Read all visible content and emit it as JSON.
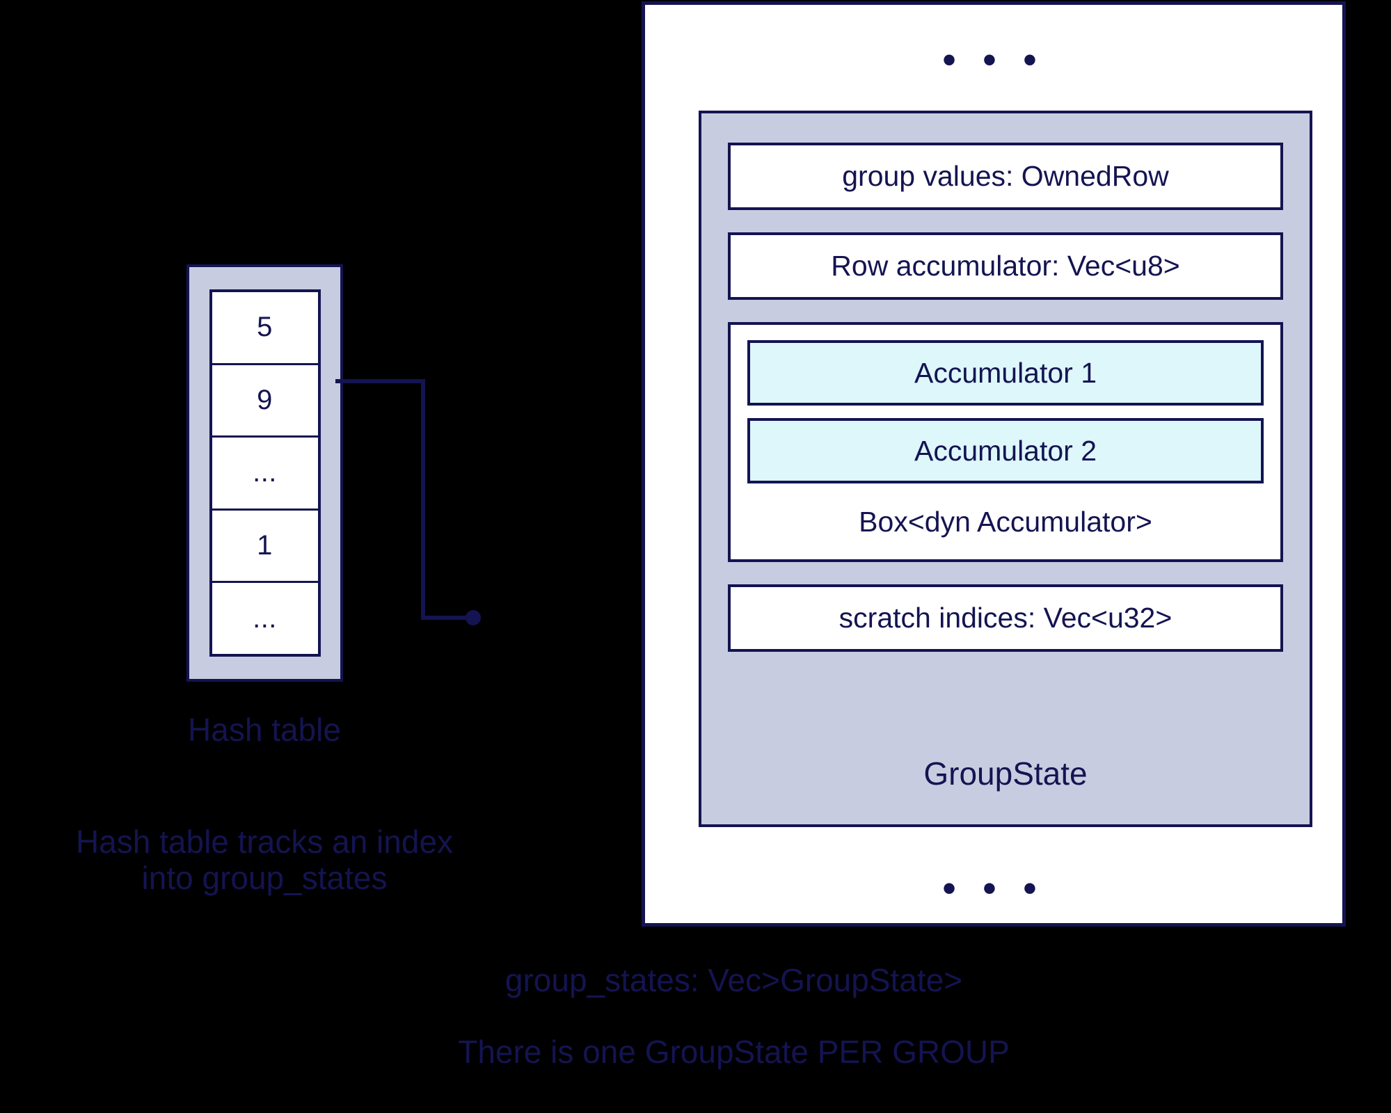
{
  "diagram": {
    "title": "GroupState / hash table layout",
    "colors": {
      "background": "#000000",
      "panel_fill": "#ffffff",
      "box_fill": "#c8cce0",
      "accumulator_fill": "#ddf7fa",
      "stroke": "#141452",
      "text": "#141452"
    }
  },
  "hash_table": {
    "cells": [
      "5",
      "9",
      "...",
      "1",
      "..."
    ],
    "label": "Hash table",
    "note_line1": "Hash table tracks an index",
    "note_line2": "into group_states"
  },
  "group_states": {
    "ellipsis_top": "• • •",
    "ellipsis_bottom": "• • •",
    "group_state": {
      "fields": [
        {
          "label": "group values: OwnedRow"
        },
        {
          "label": "Row accumulator: Vec<u8>"
        }
      ],
      "accumulators": [
        {
          "label": "Accumulator 1"
        },
        {
          "label": "Accumulator 2"
        }
      ],
      "accumulator_group_label": "Box<dyn Accumulator>",
      "scratch_field": {
        "label": "scratch indices: Vec<u32>"
      },
      "label": "GroupState"
    },
    "caption_line1": "group_states: Vec>GroupState>",
    "caption_line2": "There is one GroupState PER GROUP"
  }
}
